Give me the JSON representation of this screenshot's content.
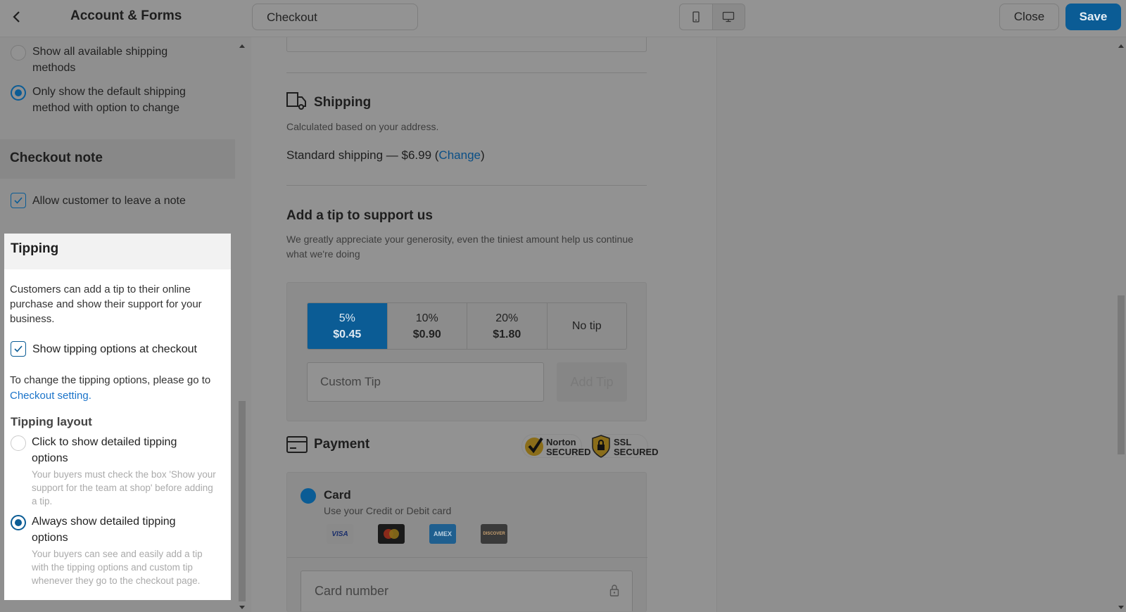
{
  "header": {
    "back_icon": "chevron-left-icon",
    "title": "Account & Forms",
    "page_select": "Checkout",
    "device_icons": [
      "mobile-icon",
      "desktop-icon"
    ],
    "close_label": "Close",
    "save_label": "Save"
  },
  "sidebar": {
    "shipping_options": [
      {
        "label": "Show all available shipping methods",
        "selected": false
      },
      {
        "label": "Only show the default shipping method with option to change",
        "selected": true
      }
    ],
    "checkout_note": {
      "title": "Checkout note",
      "allow_note_label": "Allow customer to leave a note",
      "allow_note_checked": true
    },
    "tipping": {
      "title": "Tipping",
      "description": "Customers can add a tip to their online purchase and show their support for your business.",
      "show_options_label": "Show tipping options at checkout",
      "show_options_checked": true,
      "change_text": "To change the tipping options, please go to",
      "change_link": "Checkout setting.",
      "layout_title": "Tipping layout",
      "layouts": [
        {
          "label": "Click to show detailed tipping options",
          "hint": "Your buyers must check the box 'Show your support for the team at shop' before adding a tip.",
          "selected": false
        },
        {
          "label": "Always show detailed tipping options",
          "hint": "Your buyers can see and easily add a tip with the tipping options and custom tip whenever they go to the checkout page.",
          "selected": true
        }
      ]
    }
  },
  "preview": {
    "shipping": {
      "title": "Shipping",
      "subtitle": "Calculated based on your address.",
      "method": "Standard shipping — $6.99 (",
      "change": "Change",
      "close_paren": ")"
    },
    "tip": {
      "title": "Add a tip to support us",
      "subtitle": "We greatly appreciate your generosity, even the tiniest amount help us continue what we're doing",
      "options": [
        {
          "percent": "5%",
          "amount": "$0.45",
          "active": true
        },
        {
          "percent": "10%",
          "amount": "$0.90",
          "active": false
        },
        {
          "percent": "20%",
          "amount": "$1.80",
          "active": false
        },
        {
          "percent": "No tip",
          "amount": "",
          "active": false
        }
      ],
      "custom_placeholder": "Custom Tip",
      "add_label": "Add Tip"
    },
    "payment": {
      "title": "Payment",
      "badges": [
        "Norton SECURED",
        "SSL SECURED"
      ],
      "card_title": "Card",
      "card_subtitle": "Use your Credit or Debit card",
      "card_logos": [
        "VISA",
        "mastercard",
        "AMEX",
        "DISCOVER"
      ],
      "card_number_placeholder": "Card number"
    }
  },
  "colors": {
    "accent": "#0b5c95",
    "link": "#1a73c9",
    "overlay": "#8f8f8f"
  }
}
